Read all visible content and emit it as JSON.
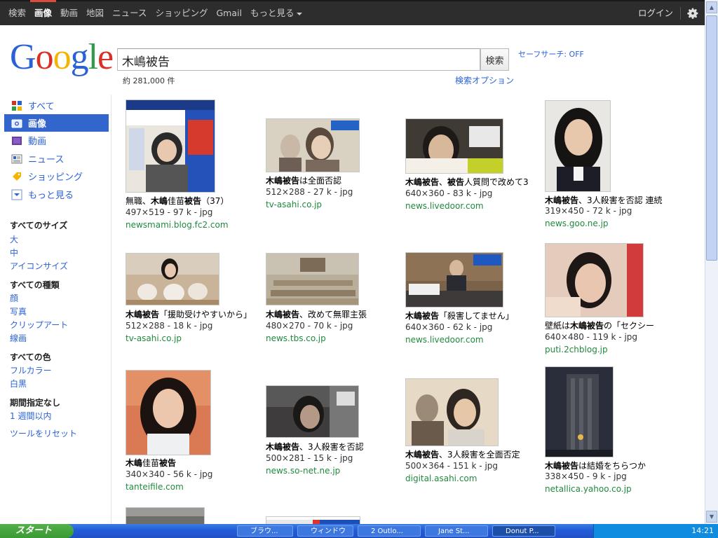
{
  "topbar": {
    "nav": [
      "検索",
      "画像",
      "動画",
      "地図",
      "ニュース",
      "ショッピング",
      "Gmail",
      "もっと見る"
    ],
    "login": "ログイン"
  },
  "logo": {
    "text": "Google"
  },
  "search": {
    "query": "木嶋被告",
    "button": "検索",
    "safesearch": "セーフサーチ: OFF",
    "result_count": "約 281,000 件",
    "options": "検索オプション"
  },
  "sidebar": {
    "items": [
      {
        "label": "すべて",
        "icon": "google-g-icon"
      },
      {
        "label": "画像",
        "icon": "image-icon"
      },
      {
        "label": "動画",
        "icon": "video-icon"
      },
      {
        "label": "ニュース",
        "icon": "news-icon"
      },
      {
        "label": "ショッピング",
        "icon": "tag-icon"
      },
      {
        "label": "もっと見る",
        "icon": "expand-icon"
      }
    ],
    "size_head": "すべてのサイズ",
    "sizes": [
      "大",
      "中",
      "アイコンサイズ"
    ],
    "type_head": "すべての種類",
    "types": [
      "顔",
      "写真",
      "クリップアート",
      "線画"
    ],
    "color_head": "すべての色",
    "colors": [
      "フルカラー",
      "白黒"
    ],
    "time_head": "期間指定なし",
    "times": [
      "1 週間以内"
    ],
    "reset": "ツールをリセット"
  },
  "results": [
    {
      "title_pre": "無職、",
      "title_bold": "木嶋",
      "title_mid": "佳苗",
      "title_bold2": "被告",
      "title_post": "（37）",
      "meta": "497×519 - 97 k - jpg",
      "domain": "newsmami.blog.fc2.com"
    },
    {
      "title_pre": "",
      "title_bold": "木嶋被告",
      "title_mid": "は全面否認",
      "title_bold2": "",
      "title_post": "",
      "meta": "512×288 - 27 k - jpg",
      "domain": "tv-asahi.co.jp"
    },
    {
      "title_pre": "",
      "title_bold": "木嶋被告",
      "title_mid": "、",
      "title_bold2": "被告",
      "title_post": "人質問で改めて3",
      "meta": "640×360 - 83 k - jpg",
      "domain": "news.livedoor.com"
    },
    {
      "title_pre": "",
      "title_bold": "木嶋被告",
      "title_mid": "、3人殺害を否認 連続",
      "title_bold2": "",
      "title_post": "",
      "meta": "319×450 - 72 k - jpg",
      "domain": "news.goo.ne.jp"
    },
    {
      "title_pre": "",
      "title_bold": "木嶋被告",
      "title_mid": "「援助受けやすいから」",
      "title_bold2": "",
      "title_post": "",
      "meta": "512×288 - 18 k - jpg",
      "domain": "tv-asahi.co.jp"
    },
    {
      "title_pre": "",
      "title_bold": "木嶋被告",
      "title_mid": "、改めて無罪主張",
      "title_bold2": "",
      "title_post": "",
      "meta": "480×270 - 70 k - jpg",
      "domain": "news.tbs.co.jp"
    },
    {
      "title_pre": "",
      "title_bold": "木嶋被告",
      "title_mid": "「殺害してません」",
      "title_bold2": "",
      "title_post": "",
      "meta": "640×360 - 62 k - jpg",
      "domain": "news.livedoor.com"
    },
    {
      "title_pre": "壁紙は",
      "title_bold": "木嶋被告",
      "title_mid": "の「セクシー",
      "title_bold2": "",
      "title_post": "",
      "meta": "640×480 - 119 k - jpg",
      "domain": "puti.2chblog.jp"
    },
    {
      "title_pre": "",
      "title_bold": "木嶋",
      "title_mid": "佳苗",
      "title_bold2": "被告",
      "title_post": "",
      "meta": "340×340 - 56 k - jpg",
      "domain": "tanteifile.com"
    },
    {
      "title_pre": "",
      "title_bold": "木嶋被告",
      "title_mid": "、3人殺害を否認",
      "title_bold2": "",
      "title_post": "",
      "meta": "500×281 - 15 k - jpg",
      "domain": "news.so-net.ne.jp"
    },
    {
      "title_pre": "",
      "title_bold": "木嶋被告",
      "title_mid": "、3人殺害を全面否定",
      "title_bold2": "",
      "title_post": "",
      "meta": "500×364 - 151 k - jpg",
      "domain": "digital.asahi.com"
    },
    {
      "title_pre": "",
      "title_bold": "木嶋被告",
      "title_mid": "は結婚をちらつか",
      "title_bold2": "",
      "title_post": "",
      "meta": "338×450 - 9 k - jpg",
      "domain": "netallica.yahoo.co.jp"
    }
  ],
  "taskbar": {
    "start": "スタート",
    "tasks": [
      "ブラウ...",
      "ウィンドウ",
      "2 Outlo...",
      "Jane St...",
      "Donut P..."
    ],
    "clock": "14:21"
  },
  "colors": {
    "link": "#2a62d6",
    "domain": "#1f8a3d",
    "active_tab": "#3366cc",
    "topbar": "#2d2d2d"
  }
}
